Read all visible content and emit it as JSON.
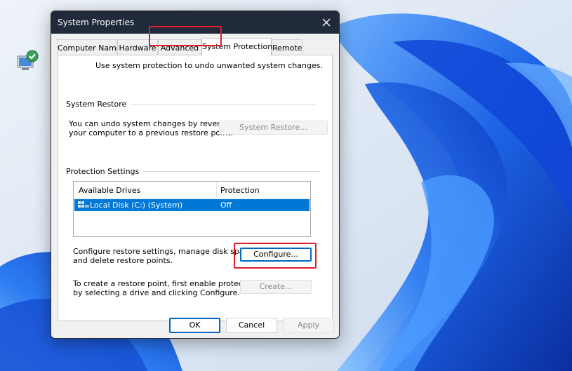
{
  "window": {
    "title": "System Properties",
    "close_glyph": "✕"
  },
  "tabs": [
    {
      "label": "Computer Name",
      "active": false
    },
    {
      "label": "Hardware",
      "active": false
    },
    {
      "label": "Advanced",
      "active": false
    },
    {
      "label": "System Protection",
      "active": true
    },
    {
      "label": "Remote",
      "active": false
    }
  ],
  "intro": {
    "icon": "system-protection-icon",
    "text": "Use system protection to undo unwanted system changes."
  },
  "system_restore": {
    "group_label": "System Restore",
    "description_line1": "You can undo system changes by reverting",
    "description_line2": "your computer to a previous restore point.",
    "button_label": "System Restore..."
  },
  "protection_settings": {
    "group_label": "Protection Settings",
    "columns": [
      "Available Drives",
      "Protection"
    ],
    "drives": [
      {
        "name": "Local Disk (C:) (System)",
        "protection": "Off",
        "selected": true,
        "icon": "drive-icon"
      }
    ],
    "configure_text_line1": "Configure restore settings, manage disk space,",
    "configure_text_line2": "and delete restore points.",
    "configure_button": "Configure...",
    "create_text_line1": "To create a restore point, first enable protection",
    "create_text_line2": "by selecting a drive and clicking Configure.",
    "create_button": "Create..."
  },
  "footer": {
    "ok": "OK",
    "cancel": "Cancel",
    "apply": "Apply"
  },
  "colors": {
    "titlebar": "#202a3a",
    "selection": "#0078d7",
    "highlight": "#e0202a",
    "accent": "#0067c0"
  }
}
